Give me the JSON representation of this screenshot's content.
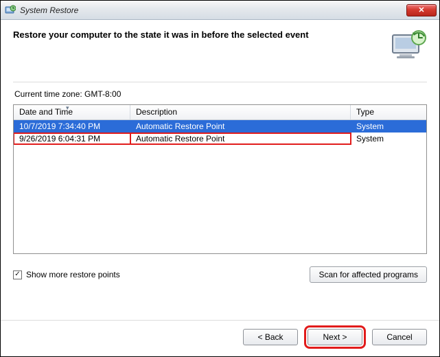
{
  "window": {
    "title": "System Restore"
  },
  "page": {
    "heading": "Restore your computer to the state it was in before the selected event",
    "timezone_label": "Current time zone: GMT-8:00"
  },
  "table": {
    "headers": {
      "datetime": "Date and Time",
      "description": "Description",
      "type": "Type"
    },
    "rows": [
      {
        "datetime": "10/7/2019 7:34:40 PM",
        "description": "Automatic Restore Point",
        "type": "System",
        "selected": true,
        "highlighted": false
      },
      {
        "datetime": "9/26/2019 6:04:31 PM",
        "description": "Automatic Restore Point",
        "type": "System",
        "selected": false,
        "highlighted": true
      }
    ]
  },
  "controls": {
    "show_more_label": "Show more restore points",
    "show_more_checked": true,
    "scan_label": "Scan for affected programs"
  },
  "footer": {
    "back": "< Back",
    "next": "Next >",
    "cancel": "Cancel"
  }
}
